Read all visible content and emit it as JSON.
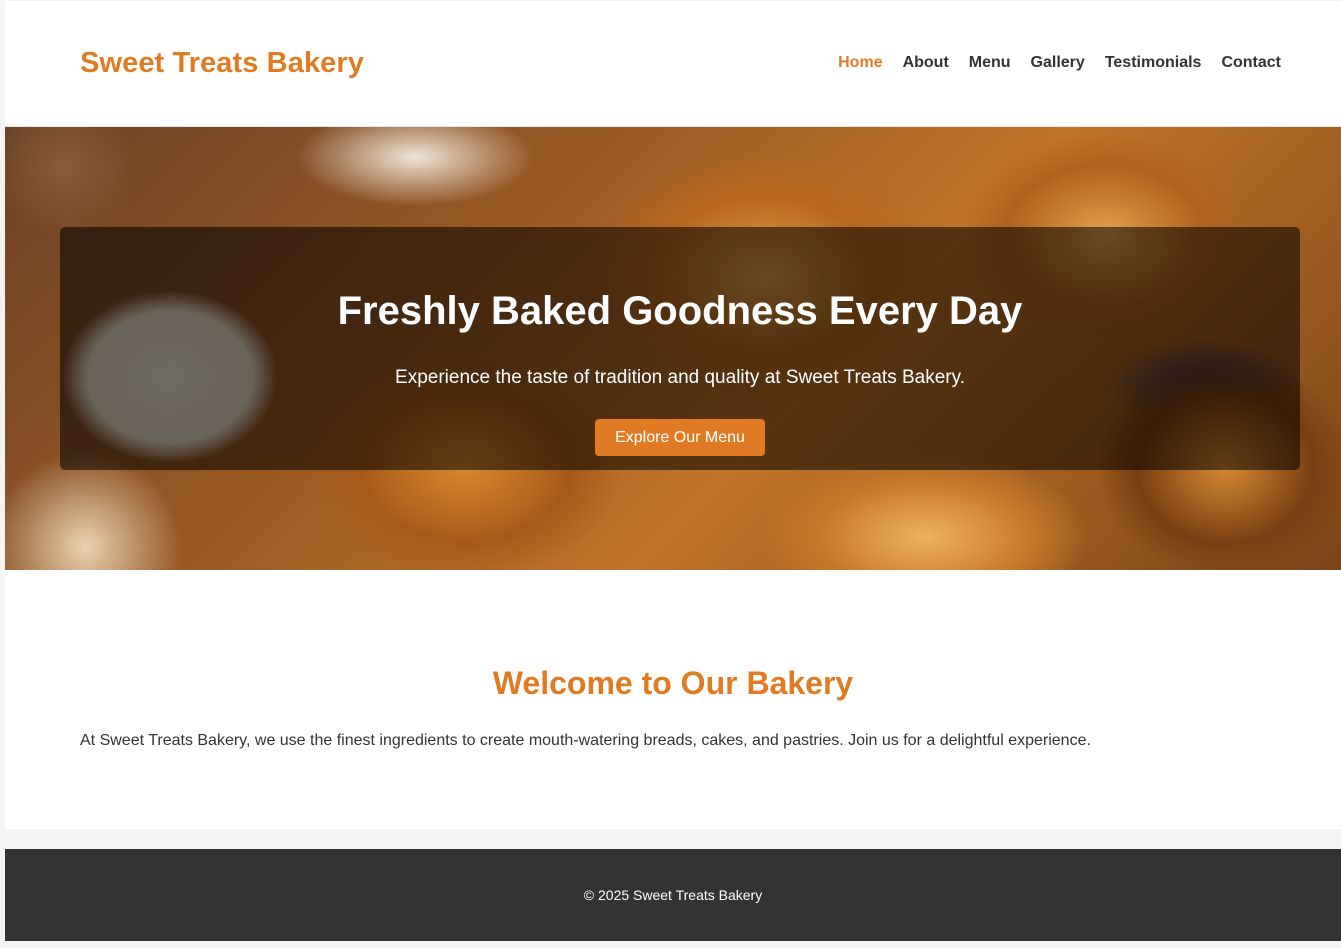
{
  "header": {
    "logo": "Sweet Treats Bakery",
    "nav": [
      {
        "label": "Home",
        "active": true
      },
      {
        "label": "About",
        "active": false
      },
      {
        "label": "Menu",
        "active": false
      },
      {
        "label": "Gallery",
        "active": false
      },
      {
        "label": "Testimonials",
        "active": false
      },
      {
        "label": "Contact",
        "active": false
      }
    ]
  },
  "hero": {
    "title": "Freshly Baked Goodness Every Day",
    "subtitle": "Experience the taste of tradition and quality at Sweet Treats Bakery.",
    "cta_label": "Explore Our Menu"
  },
  "welcome": {
    "title": "Welcome to Our Bakery",
    "text": "At Sweet Treats Bakery, we use the finest ingredients to create mouth-watering breads, cakes, and pastries. Join us for a delightful experience."
  },
  "footer": {
    "copyright": "© 2025 Sweet Treats Bakery"
  },
  "colors": {
    "accent": "#e07b24",
    "text": "#333333",
    "footer_bg": "#333333",
    "page_bg": "#f4f4f4"
  }
}
